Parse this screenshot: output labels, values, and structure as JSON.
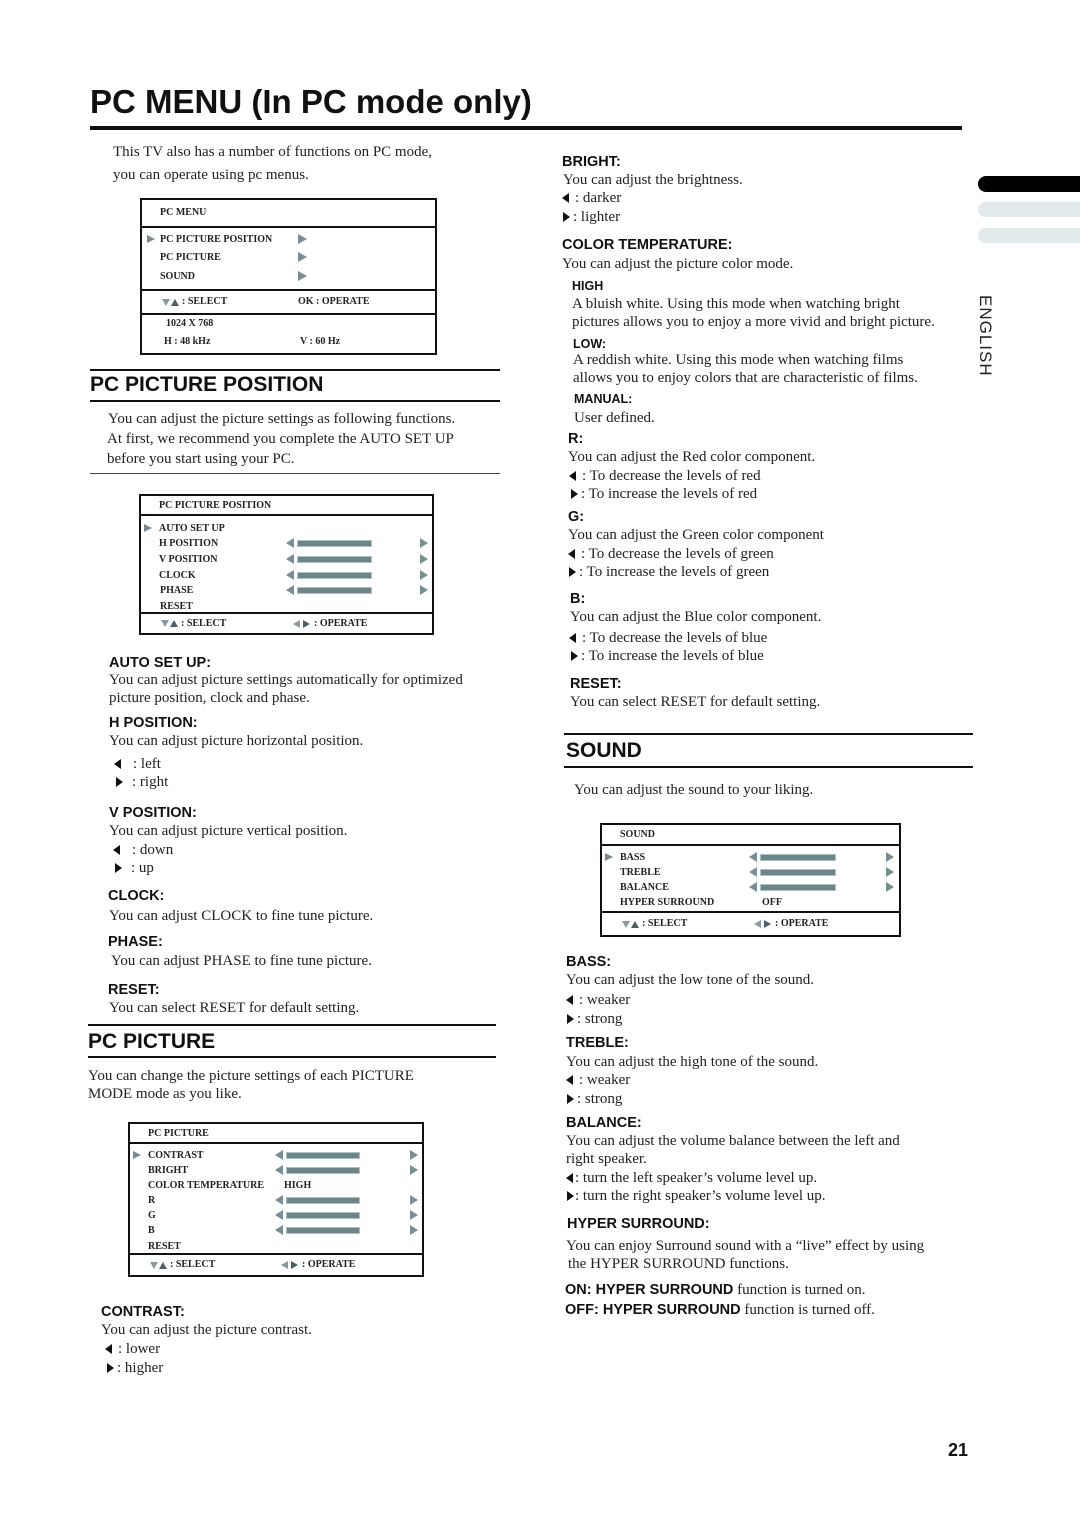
{
  "page": {
    "title": "PC MENU (In PC mode only)",
    "intro_line1": "This TV also has a number of functions on PC mode,",
    "intro_line2": "you can operate using pc menus.",
    "language_tab": "ENGLISH",
    "page_number": "21",
    "tab_colors": {
      "active": "#000000",
      "inactive": "#e3eaec"
    }
  },
  "pc_menu_osd": {
    "header": "PC MENU",
    "items": [
      {
        "label": "PC PICTURE  POSITION",
        "selected": true
      },
      {
        "label": "PC PICTURE",
        "selected": false
      },
      {
        "label": "SOUND",
        "selected": false
      }
    ],
    "select_hint": ": SELECT",
    "operate_hint": "OK : OPERATE",
    "resolution": "1024 X 768",
    "h_freq": "H : 48 kHz",
    "v_freq": "V : 60 Hz"
  },
  "pc_picture_position": {
    "title": "PC PICTURE POSITION",
    "intro_line1": "You can adjust the picture settings as following functions.",
    "intro_line2": "At first, we recommend you complete the AUTO SET UP",
    "intro_line3": "before you start using your PC.",
    "osd": {
      "header": "PC PICTURE POSITION",
      "items": [
        {
          "label": "AUTO  SET  UP",
          "selected": true,
          "slider": false
        },
        {
          "label": "H POSITION",
          "selected": false,
          "slider": true
        },
        {
          "label": "V POSITION",
          "selected": false,
          "slider": true
        },
        {
          "label": "CLOCK",
          "selected": false,
          "slider": true
        },
        {
          "label": "PHASE",
          "selected": false,
          "slider": true
        },
        {
          "label": "RESET",
          "selected": false,
          "slider": false
        }
      ],
      "select_hint": ": SELECT",
      "operate_hint": ": OPERATE"
    },
    "auto_set_up": {
      "heading": "AUTO SET UP:",
      "line1": "You can adjust picture settings automatically for optimized",
      "line2": "picture position, clock and phase."
    },
    "h_position": {
      "heading": "H POSITION:",
      "desc": "You can adjust picture horizontal position.",
      "left": ": left",
      "right": ": right"
    },
    "v_position": {
      "heading": "V POSITION:",
      "desc": "You can adjust picture vertical position.",
      "left": ": down",
      "right": ": up"
    },
    "clock": {
      "heading": "CLOCK:",
      "desc": "You can adjust CLOCK to fine tune picture."
    },
    "phase": {
      "heading": "PHASE:",
      "desc": "You can adjust PHASE to fine tune picture."
    },
    "reset": {
      "heading": "RESET:",
      "desc": "You can select RESET for default setting."
    }
  },
  "pc_picture": {
    "title": "PC PICTURE",
    "intro_line1": "You can change the picture settings of each PICTURE",
    "intro_line2": "MODE mode as you like.",
    "osd": {
      "header": "PC PICTURE",
      "items": [
        {
          "label": "CONTRAST",
          "selected": true,
          "slider": true
        },
        {
          "label": "BRIGHT",
          "selected": false,
          "slider": true
        },
        {
          "label": "COLOR TEMPERATURE",
          "selected": false,
          "slider": false,
          "value": "HIGH"
        },
        {
          "label": "R",
          "selected": false,
          "slider": true
        },
        {
          "label": "G",
          "selected": false,
          "slider": true
        },
        {
          "label": "B",
          "selected": false,
          "slider": true
        },
        {
          "label": "RESET",
          "selected": false,
          "slider": false
        }
      ],
      "select_hint": ": SELECT",
      "operate_hint": ": OPERATE"
    },
    "contrast": {
      "heading": "CONTRAST:",
      "desc": "You can adjust the picture contrast.",
      "left": ": lower",
      "right": ": higher"
    },
    "bright": {
      "heading": "BRIGHT:",
      "desc": "You can adjust the brightness.",
      "left": ": darker",
      "right": ": lighter"
    },
    "color_temperature": {
      "heading": "COLOR TEMPERATURE:",
      "desc": "You can adjust the picture color mode.",
      "high": {
        "heading": "HIGH",
        "line1": "A bluish white. Using this mode when watching bright",
        "line2": "pictures allows you to enjoy a more vivid and bright picture."
      },
      "low": {
        "heading": "LOW:",
        "line1": "A reddish white. Using this mode when watching films",
        "line2": "allows you to enjoy colors that are characteristic of films."
      },
      "manual": {
        "heading": "MANUAL:",
        "line1": "User defined."
      }
    },
    "r": {
      "heading": "R:",
      "desc": "You can adjust the Red color component.",
      "left": ": To decrease the levels of red",
      "right": ": To increase the levels of red"
    },
    "g": {
      "heading": "G:",
      "desc": "You can adjust the Green color component",
      "left": ": To decrease the levels of green",
      "right": ": To increase the levels of green"
    },
    "b": {
      "heading": "B:",
      "desc": "You can adjust the Blue color component.",
      "left": ": To decrease the levels of blue",
      "right": ": To increase the levels of blue"
    },
    "reset": {
      "heading": "RESET:",
      "desc": "You can select RESET for default setting."
    }
  },
  "sound": {
    "title": "SOUND",
    "intro": "You can adjust the sound to your liking.",
    "osd": {
      "header": "SOUND",
      "items": [
        {
          "label": "BASS",
          "selected": true,
          "slider": true
        },
        {
          "label": "TREBLE",
          "selected": false,
          "slider": true
        },
        {
          "label": "BALANCE",
          "selected": false,
          "slider": true
        },
        {
          "label": "HYPER SURROUND",
          "selected": false,
          "slider": false,
          "value": "OFF"
        }
      ],
      "select_hint": ": SELECT",
      "operate_hint": ": OPERATE"
    },
    "bass": {
      "heading": "BASS:",
      "desc": "You can adjust the low tone of the sound.",
      "left": ": weaker",
      "right": ": strong"
    },
    "treble": {
      "heading": "TREBLE:",
      "desc": "You can adjust the high tone of the sound.",
      "left": ": weaker",
      "right": ": strong"
    },
    "balance": {
      "heading": "BALANCE:",
      "line1": "You can adjust the volume balance between the left and",
      "line2": "right speaker.",
      "left": ": turn the left speaker’s volume level up.",
      "right": ": turn the right speaker’s volume level up."
    },
    "hyper_surround": {
      "heading": "HYPER SURROUND:",
      "line1": "You can enjoy Surround sound with a “live” effect by  using",
      "line2": "the  HYPER SURROUND functions.",
      "on_bold": "ON: HYPER SURROUND",
      "on_text": " function is turned on.",
      "off_bold": "OFF: HYPER SURROUND",
      "off_text": " function is turned off."
    }
  }
}
